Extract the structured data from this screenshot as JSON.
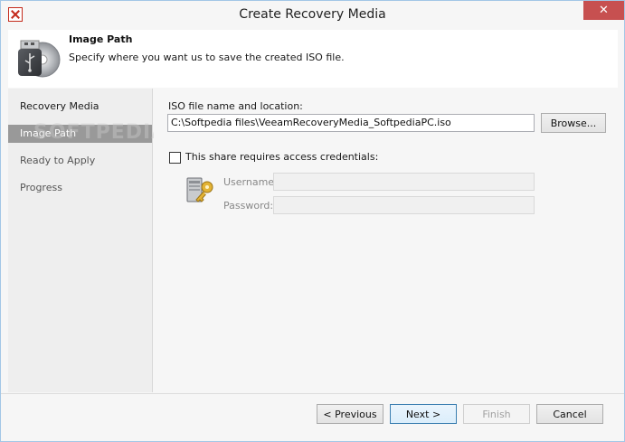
{
  "window": {
    "title": "Create Recovery Media",
    "app_icon": "veeam-x-icon",
    "close_icon": "close-icon",
    "close_glyph": "✕"
  },
  "header": {
    "title": "Image Path",
    "description": "Specify where you want us to save the created ISO file.",
    "icon": "usb-disc-icon"
  },
  "nav": {
    "items": [
      {
        "label": "Recovery Media",
        "state": "done"
      },
      {
        "label": "Image Path",
        "state": "active"
      },
      {
        "label": "Ready to Apply",
        "state": "pending"
      },
      {
        "label": "Progress",
        "state": "pending"
      }
    ]
  },
  "watermark": "SOFTPEDIA",
  "form": {
    "iso_label": "ISO file name and location:",
    "iso_value": "C:\\Softpedia files\\VeeamRecoveryMedia_SoftpediaPC.iso",
    "browse_label": "Browse...",
    "credentials_checkbox_label": "This share requires access credentials:",
    "credentials_checked": false,
    "credentials_icon": "key-computer-icon",
    "username_label": "Username:",
    "username_value": "",
    "password_label": "Password:",
    "password_value": ""
  },
  "footer": {
    "previous_label": "< Previous",
    "next_label": "Next >",
    "finish_label": "Finish",
    "cancel_label": "Cancel"
  }
}
